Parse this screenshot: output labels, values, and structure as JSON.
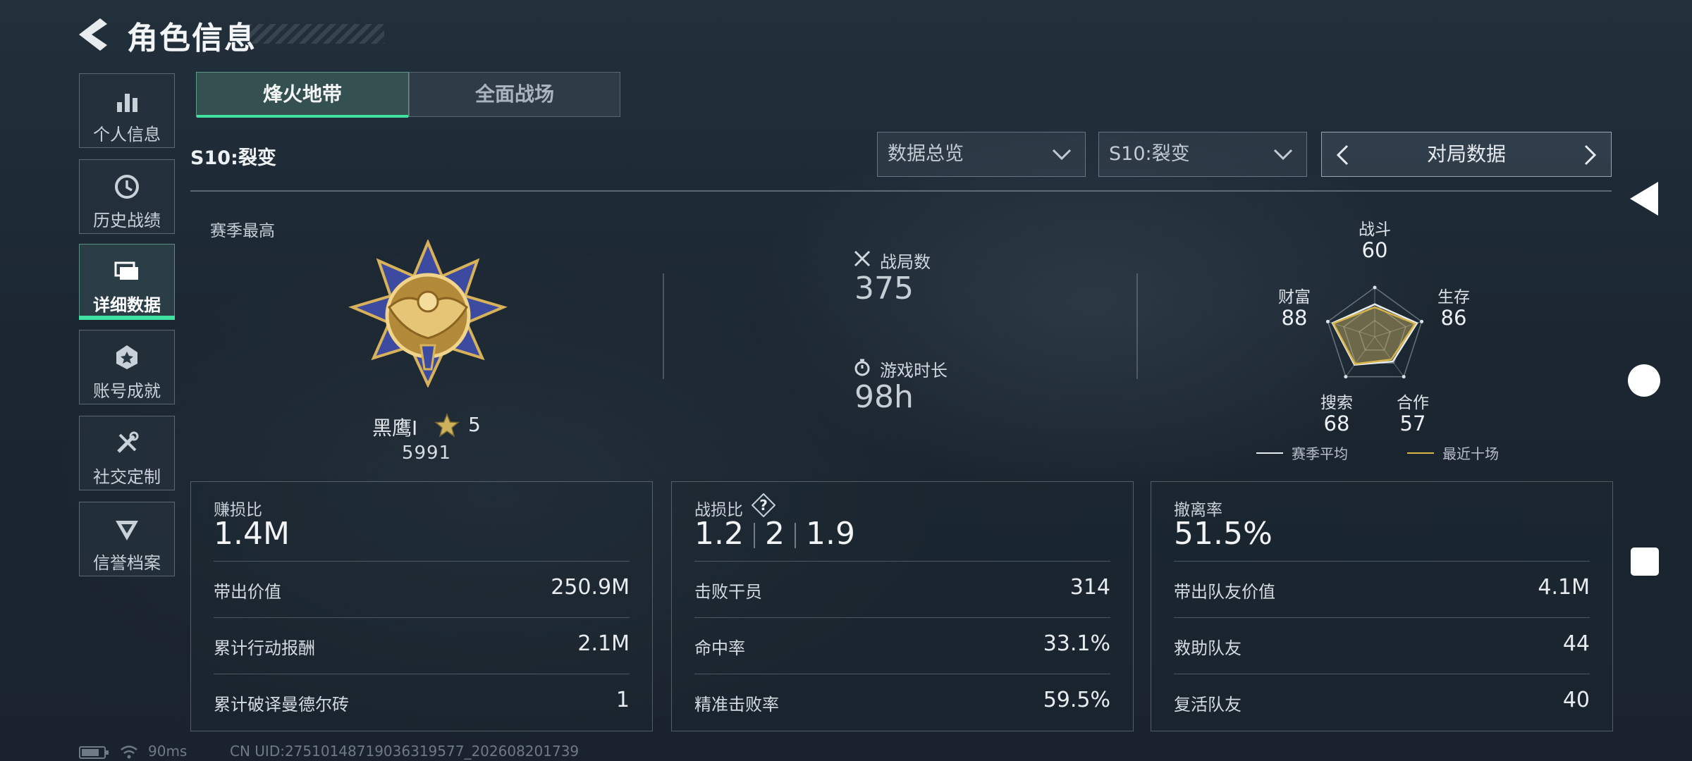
{
  "header": {
    "title": "角色信息",
    "back_icon": "back-arrow-icon"
  },
  "sidebar": {
    "items": [
      {
        "label": "个人信息",
        "icon": "bar-chart-icon",
        "active": false
      },
      {
        "label": "历史战绩",
        "icon": "history-clock-icon",
        "active": false
      },
      {
        "label": "详细数据",
        "icon": "folder-icon",
        "active": true
      },
      {
        "label": "账号成就",
        "icon": "achievement-icon",
        "active": false
      },
      {
        "label": "社交定制",
        "icon": "tools-icon",
        "active": false
      },
      {
        "label": "信誉档案",
        "icon": "emblem-icon",
        "active": false
      }
    ]
  },
  "tabs": [
    {
      "label": "烽火地带",
      "active": true
    },
    {
      "label": "全面战场",
      "active": false
    }
  ],
  "season_label": "S10:裂变",
  "filters": {
    "category": "数据总览",
    "season": "S10:裂变",
    "view": "对局数据"
  },
  "overview": {
    "season_best_label": "赛季最高",
    "rank_name": "黑鹰Ⅰ",
    "rank_stars": "5",
    "rank_score": "5991",
    "matches_label": "战局数",
    "matches_value": "375",
    "playtime_label": "游戏时长",
    "playtime_value": "98h"
  },
  "radar": {
    "axes": [
      {
        "label": "战斗",
        "value": "60"
      },
      {
        "label": "生存",
        "value": "86"
      },
      {
        "label": "合作",
        "value": "57"
      },
      {
        "label": "搜索",
        "value": "68"
      },
      {
        "label": "财富",
        "value": "88"
      }
    ],
    "recent_scores": [
      60,
      86,
      57,
      68,
      88
    ],
    "season_avg_scores": [
      66,
      90,
      62,
      70,
      90
    ],
    "legend": [
      {
        "label": "赛季平均",
        "color": "#e8ecef"
      },
      {
        "label": "最近十场",
        "color": "#d9b64a"
      }
    ]
  },
  "panels": {
    "profit": {
      "title": "赚损比",
      "value": "1.4M",
      "rows": [
        {
          "label": "带出价值",
          "value": "250.9M"
        },
        {
          "label": "累计行动报酬",
          "value": "2.1M"
        },
        {
          "label": "累计破译曼德尔砖",
          "value": "1"
        }
      ]
    },
    "combat": {
      "title": "战损比",
      "ratio": [
        "1.2",
        "2",
        "1.9"
      ],
      "rows": [
        {
          "label": "击败干员",
          "value": "314"
        },
        {
          "label": "命中率",
          "value": "33.1%"
        },
        {
          "label": "精准击败率",
          "value": "59.5%"
        }
      ]
    },
    "extract": {
      "title": "撤离率",
      "value": "51.5%",
      "rows": [
        {
          "label": "带出队友价值",
          "value": "4.1M"
        },
        {
          "label": "救助队友",
          "value": "44"
        },
        {
          "label": "复活队友",
          "value": "40"
        }
      ]
    }
  },
  "status_bar": {
    "ping": "90ms",
    "uid": "CN UID:27510148719036319577_202608201739"
  },
  "colors": {
    "accent": "#3fe0a0",
    "gold": "#d9b64a"
  }
}
